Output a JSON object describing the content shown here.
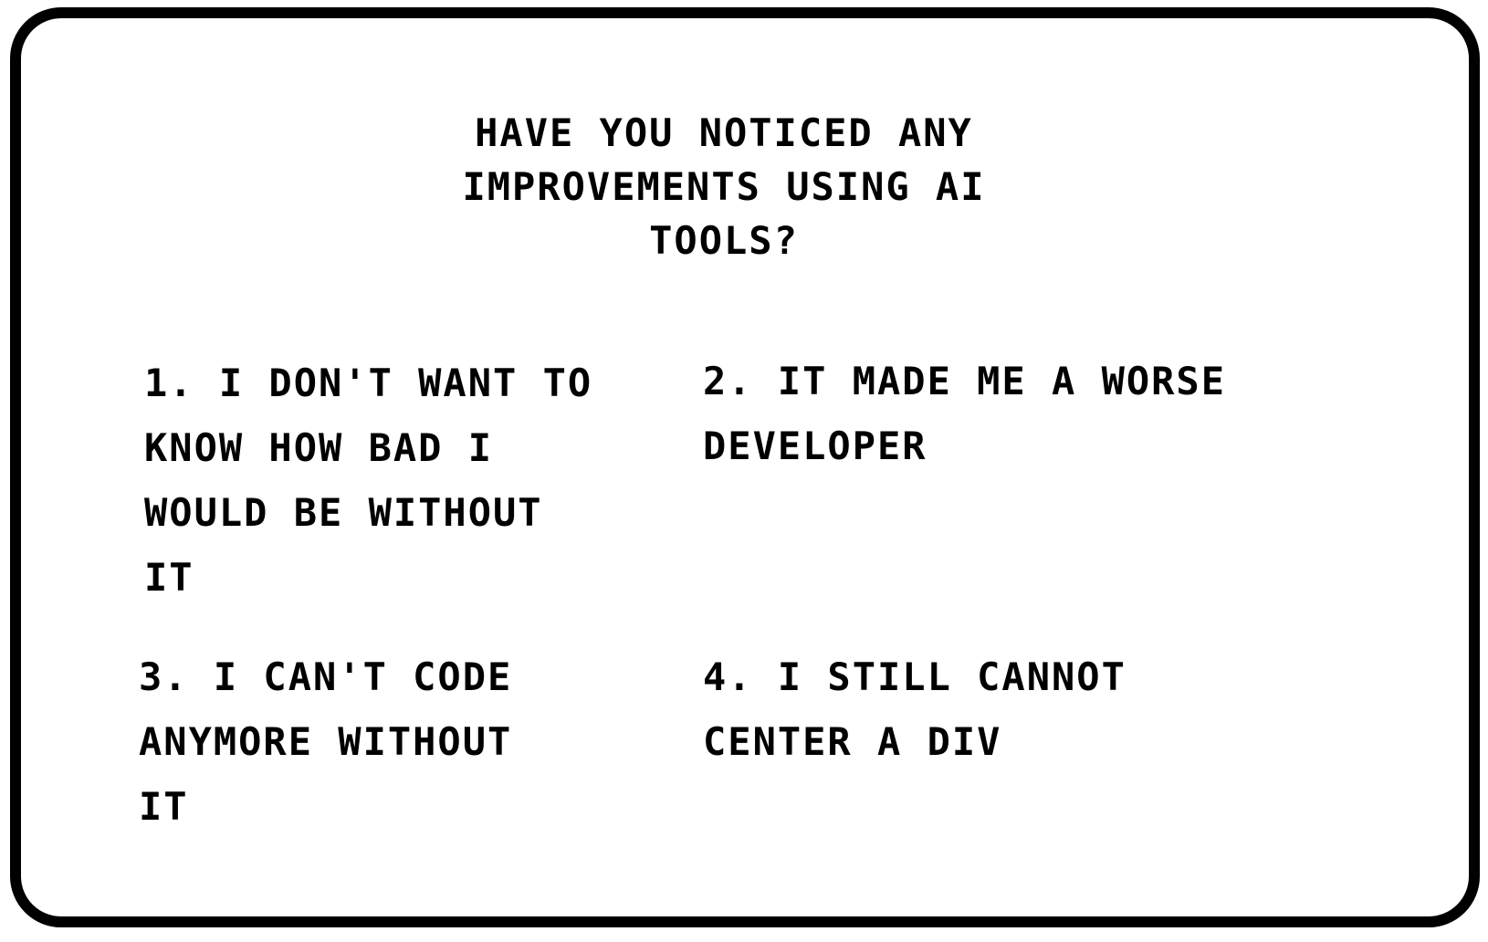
{
  "question": {
    "lines": [
      "HAVE YOU NOTICED ANY",
      "IMPROVEMENTS USING AI",
      "TOOLS?"
    ]
  },
  "answers": [
    {
      "lines": [
        "1. I DON'T WANT TO",
        "KNOW HOW BAD I",
        "WOULD BE WITHOUT",
        "IT"
      ]
    },
    {
      "lines": [
        "2. IT MADE ME A WORSE",
        "DEVELOPER"
      ]
    },
    {
      "lines": [
        "3. I CAN'T CODE",
        "ANYMORE WITHOUT",
        "IT"
      ]
    },
    {
      "lines": [
        "4. I STILL CANNOT",
        "CENTER A DIV"
      ]
    }
  ]
}
